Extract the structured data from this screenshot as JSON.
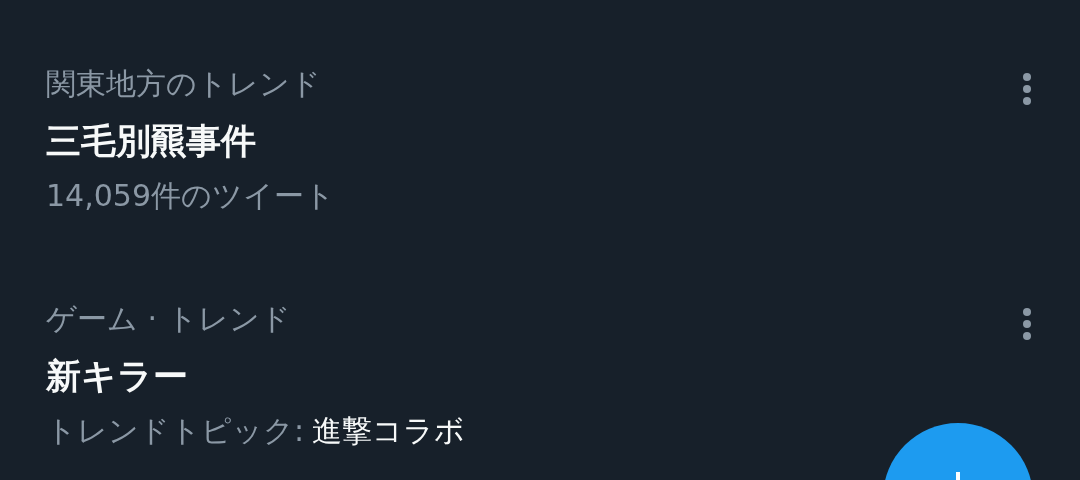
{
  "trends": [
    {
      "kind": "count",
      "category": "関東地方のトレンド",
      "title": "三毛別羆事件",
      "meta": {
        "value": "14,059件のツイート"
      }
    },
    {
      "kind": "topic",
      "category": "ゲーム · トレンド",
      "title": "新キラー",
      "meta": {
        "label": "トレンドトピック:",
        "value": "進撃コラボ"
      }
    }
  ]
}
